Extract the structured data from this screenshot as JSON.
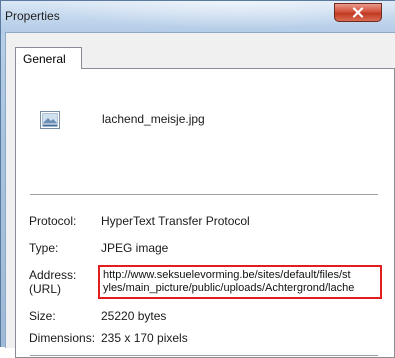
{
  "window": {
    "title": "Properties",
    "close_glyph": "x"
  },
  "tabs": [
    {
      "label": "General",
      "active": true
    }
  ],
  "file": {
    "icon": "image-file-icon",
    "name": "lachend_meisje.jpg"
  },
  "properties": {
    "protocol": {
      "label": "Protocol:",
      "value": "HyperText Transfer Protocol"
    },
    "type": {
      "label": "Type:",
      "value": "JPEG image"
    },
    "address": {
      "label_line1": "Address:",
      "label_line2": "(URL)",
      "value_line1": "http://www.seksuelevorming.be/sites/default/files/st",
      "value_line2": "yles/main_picture/public/uploads/Achtergrond/lache",
      "highlight_color": "#e01e1e"
    },
    "size": {
      "label": "Size:",
      "value": "25220 bytes"
    },
    "dimensions": {
      "label": "Dimensions:",
      "value": "235 x 170 pixels"
    }
  },
  "colors": {
    "close_button": "#c13a22",
    "highlight": "#e01e1e",
    "title_bar": "#c4d8ee"
  }
}
